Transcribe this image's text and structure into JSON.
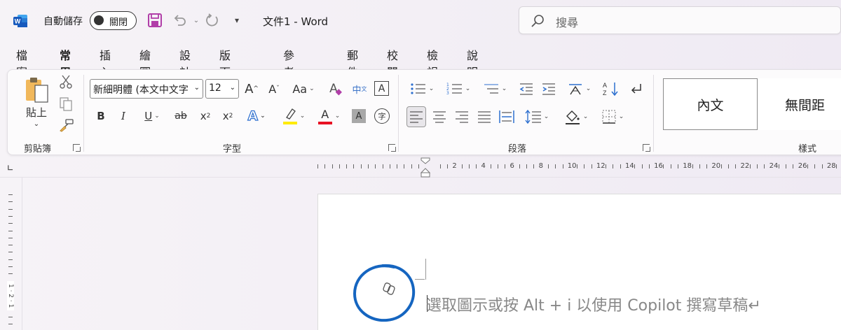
{
  "titlebar": {
    "autosave_label": "自動儲存",
    "autosave_state": "關閉",
    "doc_title": "文件1 - Word",
    "icons": [
      "word-logo-icon",
      "save-icon",
      "undo-icon",
      "redo-icon",
      "customize-toolbar-icon"
    ]
  },
  "search": {
    "placeholder": "搜尋"
  },
  "tabs": [
    "檔案",
    "常用",
    "插入",
    "繪圖",
    "設計",
    "版面配置",
    "參考資料",
    "郵件",
    "校閱",
    "檢視",
    "說明"
  ],
  "active_tab": "常用",
  "clipboard": {
    "paste_label": "貼上",
    "group_label": "剪貼簿"
  },
  "font": {
    "name": "新細明體 (本文中文字",
    "size": "12",
    "group_label": "字型",
    "grow": "A",
    "shrink": "A",
    "case": "Aa",
    "clear_format": "A",
    "phonetic": "中",
    "char_border": "A",
    "bold": "B",
    "italic": "I",
    "underline": "U",
    "strike": "ab",
    "subscript": "x",
    "superscript": "x",
    "text_effect": "A",
    "font_color": "A",
    "char_shading": "A",
    "enclose": "字",
    "highlight_color": "#ffeb00",
    "font_color_value": "#e81123"
  },
  "paragraph": {
    "group_label": "段落"
  },
  "styles": {
    "group_label": "樣式",
    "items": [
      "內文",
      "無間距"
    ]
  },
  "ruler": {
    "labels": [
      "2",
      "4",
      "6",
      "8",
      "10",
      "12",
      "14",
      "16",
      "18",
      "20",
      "22",
      "24",
      "26",
      "28"
    ]
  },
  "vruler": {
    "labels": [
      "1",
      "2",
      "1"
    ]
  },
  "document": {
    "hint": "選取圖示或按  Alt  +  i  以使用  Copilot  撰寫草稿↵"
  },
  "colors": {
    "accent": "#185abd",
    "annotation_circle": "#1565c0"
  }
}
